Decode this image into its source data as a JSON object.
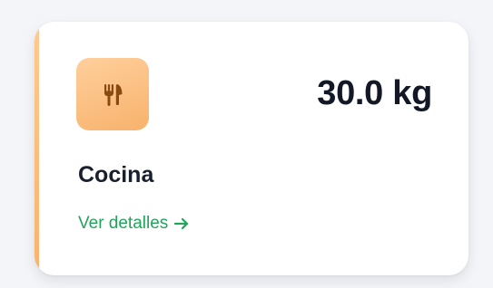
{
  "card": {
    "value": "30.0 kg",
    "category": "Cocina",
    "link_label": "Ver detalles",
    "icon": "utensils-icon",
    "link_icon": "arrow-right-icon"
  },
  "colors": {
    "accent": "#f9b36b",
    "icon_tile": "#f7b26c",
    "icon_glyph": "#8a4a12",
    "link": "#22a45a",
    "value_text": "#121826"
  }
}
